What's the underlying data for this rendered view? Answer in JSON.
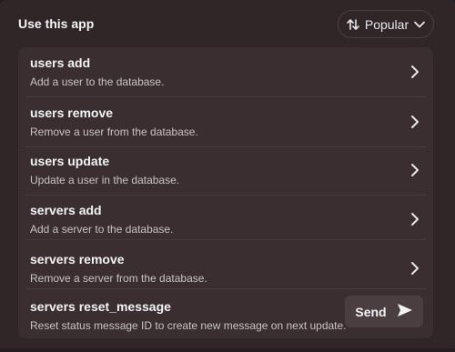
{
  "header": {
    "title": "Use this app",
    "sort_label": "Popular"
  },
  "commands": [
    {
      "name": "users add",
      "description": "Add a user to the database."
    },
    {
      "name": "users remove",
      "description": "Remove a user from the database."
    },
    {
      "name": "users update",
      "description": "Update a user in the database."
    },
    {
      "name": "servers add",
      "description": "Add a server to the database."
    },
    {
      "name": "servers remove",
      "description": "Remove a server from the database."
    },
    {
      "name": "servers reset_message",
      "description": "Reset status message ID to create new message on next update."
    }
  ],
  "send_label": "Send",
  "icons": {
    "sort": "sort-arrows-icon",
    "dropdown": "chevron-down-icon",
    "row": "chevron-right-icon",
    "send": "send-arrow-icon"
  },
  "colors": {
    "panel_bg": "#302628",
    "list_bg": "#3a2e31",
    "text": "#f2f3f5",
    "muted_text": "#c9c3c4"
  }
}
